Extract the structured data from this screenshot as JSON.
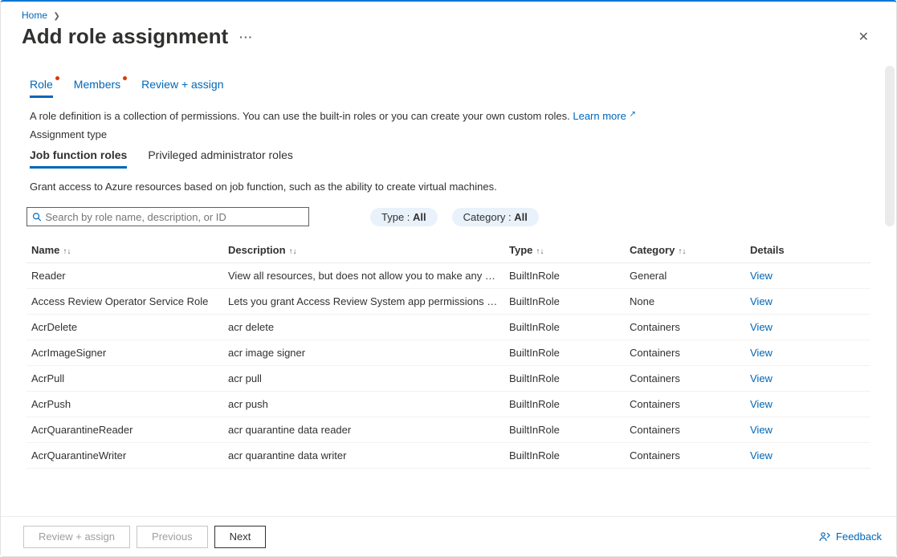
{
  "breadcrumb": {
    "home": "Home"
  },
  "header": {
    "title": "Add role assignment",
    "more_glyph": "···"
  },
  "steps": [
    {
      "label": "Role",
      "active": true,
      "dot": true
    },
    {
      "label": "Members",
      "active": false,
      "dot": true
    },
    {
      "label": "Review + assign",
      "active": false,
      "dot": false
    }
  ],
  "description": {
    "text": "A role definition is a collection of permissions. You can use the built-in roles or you can create your own custom roles. ",
    "learn_more": "Learn more"
  },
  "assignment_type_label": "Assignment type",
  "role_type_tabs": [
    {
      "label": "Job function roles",
      "active": true
    },
    {
      "label": "Privileged administrator roles",
      "active": false
    }
  ],
  "helper_text": "Grant access to Azure resources based on job function, such as the ability to create virtual machines.",
  "search": {
    "placeholder": "Search by role name, description, or ID"
  },
  "filters": {
    "type": {
      "label": "Type : ",
      "value": "All"
    },
    "category": {
      "label": "Category : ",
      "value": "All"
    }
  },
  "columns": {
    "name": "Name",
    "description": "Description",
    "type": "Type",
    "category": "Category",
    "details": "Details"
  },
  "view_label": "View",
  "rows": [
    {
      "name": "Reader",
      "description": "View all resources, but does not allow you to make any ch…",
      "type": "BuiltInRole",
      "category": "General"
    },
    {
      "name": "Access Review Operator Service Role",
      "description": "Lets you grant Access Review System app permissions to …",
      "type": "BuiltInRole",
      "category": "None"
    },
    {
      "name": "AcrDelete",
      "description": "acr delete",
      "type": "BuiltInRole",
      "category": "Containers"
    },
    {
      "name": "AcrImageSigner",
      "description": "acr image signer",
      "type": "BuiltInRole",
      "category": "Containers"
    },
    {
      "name": "AcrPull",
      "description": "acr pull",
      "type": "BuiltInRole",
      "category": "Containers"
    },
    {
      "name": "AcrPush",
      "description": "acr push",
      "type": "BuiltInRole",
      "category": "Containers"
    },
    {
      "name": "AcrQuarantineReader",
      "description": "acr quarantine data reader",
      "type": "BuiltInRole",
      "category": "Containers"
    },
    {
      "name": "AcrQuarantineWriter",
      "description": "acr quarantine data writer",
      "type": "BuiltInRole",
      "category": "Containers"
    }
  ],
  "footer": {
    "review_assign": "Review + assign",
    "previous": "Previous",
    "next": "Next",
    "feedback": "Feedback"
  }
}
